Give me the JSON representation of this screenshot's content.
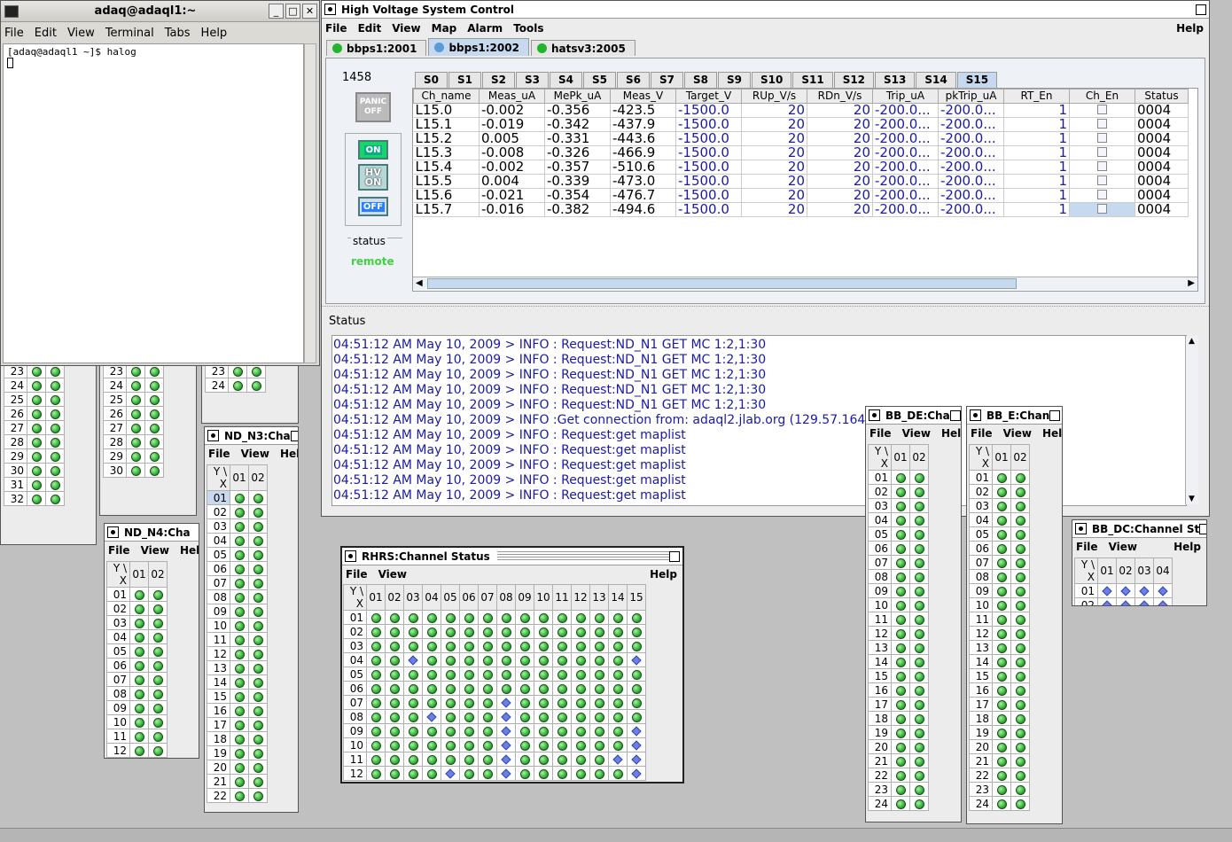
{
  "terminal": {
    "title": "adaq@adaql1:~",
    "menus": [
      "File",
      "Edit",
      "View",
      "Terminal",
      "Tabs",
      "Help"
    ],
    "prompt": "[adaq@adaql1 ~]$ halog"
  },
  "hv": {
    "title": "High Voltage System Control",
    "menus": [
      "File",
      "Edit",
      "View",
      "Map",
      "Alarm",
      "Tools"
    ],
    "help": "Help",
    "tabs": [
      "bbps1:2001",
      "bbps1:2002",
      "hatsv3:2005"
    ],
    "slots": [
      "S0",
      "S1",
      "S2",
      "S3",
      "S4",
      "S5",
      "S6",
      "S7",
      "S8",
      "S9",
      "S10",
      "S11",
      "S12",
      "S13",
      "S14",
      "S15"
    ],
    "crate": "1458",
    "panic": "PANIC OFF",
    "on": "ON",
    "hvon": "HV ON",
    "off": "OFF",
    "status_label": "status",
    "status_value": "remote",
    "columns": [
      "Ch_name",
      "Meas_uA",
      "MePk_uA",
      "Meas_V",
      "Target_V",
      "RUp_V/s",
      "RDn_V/s",
      "Trip_uA",
      "pkTrip_uA",
      "RT_En",
      "Ch_En",
      "Status"
    ],
    "rows": [
      [
        "L15.0",
        "-0.002",
        "-0.356",
        "-423.5",
        "-1500.0",
        "20",
        "20",
        "-200.0...",
        "-200.0...",
        "1",
        "",
        "0004"
      ],
      [
        "L15.1",
        "-0.019",
        "-0.342",
        "-437.9",
        "-1500.0",
        "20",
        "20",
        "-200.0...",
        "-200.0...",
        "1",
        "",
        "0004"
      ],
      [
        "L15.2",
        "0.005",
        "-0.331",
        "-443.6",
        "-1500.0",
        "20",
        "20",
        "-200.0...",
        "-200.0...",
        "1",
        "",
        "0004"
      ],
      [
        "L15.3",
        "-0.008",
        "-0.326",
        "-466.9",
        "-1500.0",
        "20",
        "20",
        "-200.0...",
        "-200.0...",
        "1",
        "",
        "0004"
      ],
      [
        "L15.4",
        "-0.002",
        "-0.357",
        "-510.6",
        "-1500.0",
        "20",
        "20",
        "-200.0...",
        "-200.0...",
        "1",
        "",
        "0004"
      ],
      [
        "L15.5",
        "0.004",
        "-0.339",
        "-473.0",
        "-1500.0",
        "20",
        "20",
        "-200.0...",
        "-200.0...",
        "1",
        "",
        "0004"
      ],
      [
        "L15.6",
        "-0.021",
        "-0.354",
        "-476.7",
        "-1500.0",
        "20",
        "20",
        "-200.0...",
        "-200.0...",
        "1",
        "",
        "0004"
      ],
      [
        "L15.7",
        "-0.016",
        "-0.382",
        "-494.6",
        "-1500.0",
        "20",
        "20",
        "-200.0...",
        "-200.0...",
        "1",
        "",
        "0004"
      ]
    ],
    "log_title": "Status",
    "log": [
      "04:51:12 AM May 10, 2009 > INFO : Request:ND_N1 GET MC 1:2,1:30",
      "04:51:12 AM May 10, 2009 > INFO : Request:ND_N1 GET MC 1:2,1:30",
      "04:51:12 AM May 10, 2009 > INFO : Request:ND_N1 GET MC 1:2,1:30",
      "04:51:12 AM May 10, 2009 > INFO : Request:ND_N1 GET MC 1:2,1:30",
      "04:51:12 AM May 10, 2009 > INFO : Request:ND_N1 GET MC 1:2,1:30",
      "04:51:12 AM May 10, 2009 > INFO :Get connection from: adaql2.jlab.org (129.57.164.59)",
      "04:51:12 AM May 10, 2009 > INFO : Request:get maplist",
      "04:51:12 AM May 10, 2009 > INFO : Request:get maplist",
      "04:51:12 AM May 10, 2009 > INFO : Request:get maplist",
      "04:51:12 AM May 10, 2009 > INFO : Request:get maplist",
      "04:51:12 AM May 10, 2009 > INFO : Request:get maplist"
    ]
  },
  "small_menus": [
    "File",
    "View",
    "Help"
  ],
  "ndn4": {
    "title": "ND_N4:Cha",
    "cols": [
      "01",
      "02"
    ],
    "rows": [
      "01",
      "02",
      "03",
      "04",
      "05",
      "06",
      "07",
      "08",
      "09",
      "10",
      "11",
      "12"
    ]
  },
  "ndn3": {
    "title": "ND_N3:Cha",
    "cols": [
      "01",
      "02"
    ],
    "rows": [
      "01",
      "02",
      "03",
      "04",
      "05",
      "06",
      "07",
      "08",
      "09",
      "10",
      "11",
      "12",
      "13",
      "14",
      "15",
      "16",
      "17",
      "18",
      "19",
      "20",
      "21",
      "22"
    ]
  },
  "rhrs": {
    "title": "RHRS:Channel Status",
    "cols": [
      "01",
      "02",
      "03",
      "04",
      "05",
      "06",
      "07",
      "08",
      "09",
      "10",
      "11",
      "12",
      "13",
      "14",
      "15"
    ],
    "rows": [
      "01",
      "02",
      "03",
      "04",
      "05",
      "06",
      "07",
      "08",
      "09",
      "10",
      "11",
      "12"
    ],
    "diamonds": {
      "04": [
        "03",
        "15"
      ],
      "07": [
        "08"
      ],
      "08": [
        "04",
        "08"
      ],
      "09": [
        "08",
        "15"
      ],
      "10": [
        "08",
        "15"
      ],
      "11": [
        "08",
        "14",
        "15"
      ],
      "12": [
        "05",
        "08",
        "15"
      ]
    }
  },
  "bbde": {
    "title": "BB_DE:Cha",
    "cols": [
      "01",
      "02"
    ],
    "rows": [
      "01",
      "02",
      "03",
      "04",
      "05",
      "06",
      "07",
      "08",
      "09",
      "10",
      "11",
      "12",
      "13",
      "14",
      "15",
      "16",
      "17",
      "18",
      "19",
      "20",
      "21",
      "22",
      "23",
      "24"
    ]
  },
  "bbe": {
    "title": "BB_E:Chan",
    "cols": [
      "01",
      "02"
    ],
    "rows": [
      "01",
      "02",
      "03",
      "04",
      "05",
      "06",
      "07",
      "08",
      "09",
      "10",
      "11",
      "12",
      "13",
      "14",
      "15",
      "16",
      "17",
      "18",
      "19",
      "20",
      "21",
      "22",
      "23",
      "24"
    ]
  },
  "bbdc": {
    "title": "BB_DC:Channel St",
    "cols": [
      "01",
      "02",
      "03",
      "04"
    ],
    "rows": [
      "01",
      "02"
    ]
  },
  "behind1": {
    "rows": [
      "23",
      "24",
      "25",
      "26",
      "27",
      "28",
      "29",
      "30",
      "31",
      "32"
    ]
  },
  "behind2": {
    "rows": [
      "23",
      "24",
      "25",
      "26",
      "27",
      "28",
      "29",
      "30"
    ]
  },
  "behind3": {
    "rows": [
      "23",
      "24"
    ]
  },
  "yx": "Y \\ X",
  "colors": {
    "log_text": "#1a1aa8",
    "remote": "#44d044",
    "tab_sel": "#c7d9ee"
  }
}
